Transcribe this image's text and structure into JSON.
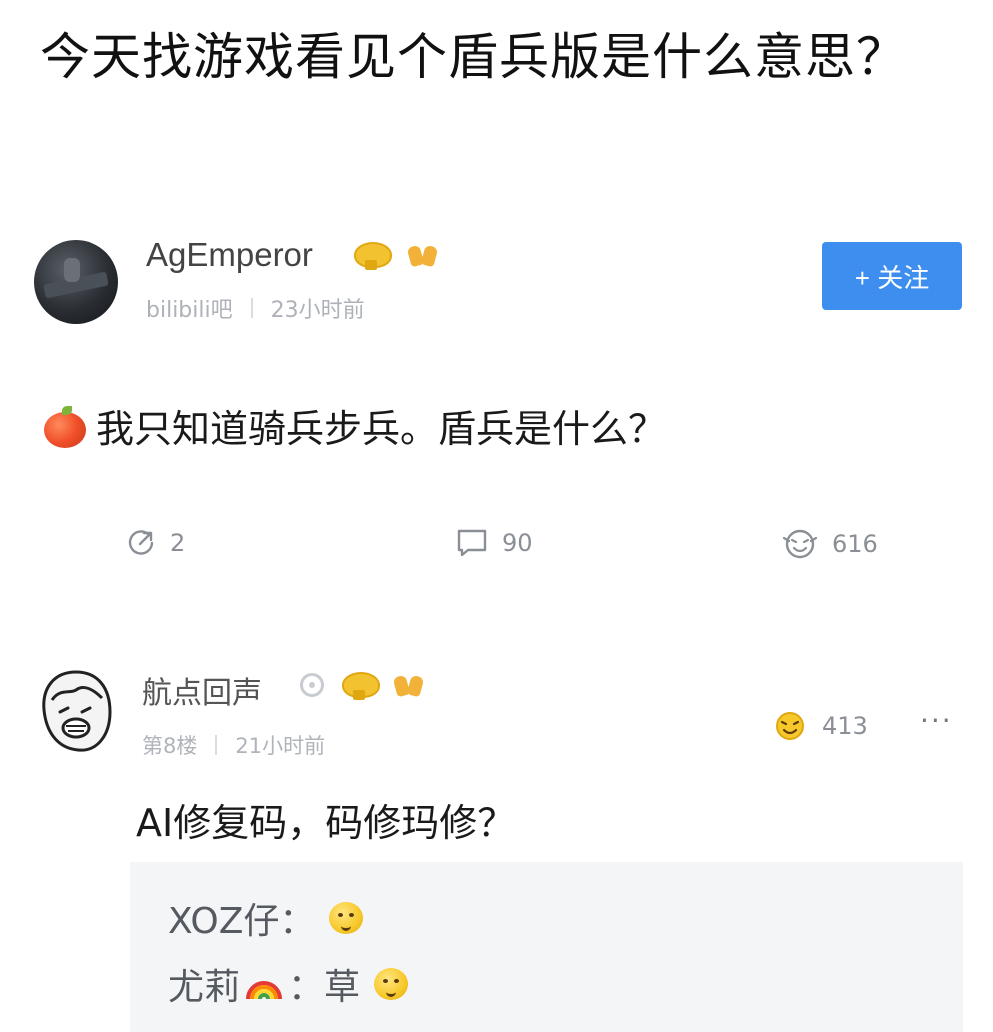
{
  "post": {
    "title": "今天找游戏看见个盾兵版是什么意思？",
    "author": {
      "name": "AgEmperor",
      "source": "bilibili吧",
      "time": "23小时前",
      "badge_icons": [
        "gold-medal-icon",
        "praying-hands-icon"
      ]
    },
    "follow_label": "+ 关注",
    "body_icon": "apple-icon",
    "body": "我只知道骑兵步兵。盾兵是什么？",
    "actions": {
      "share_count": "2",
      "comment_count": "90",
      "like_count": "616"
    }
  },
  "comment": {
    "author": "航点回声",
    "floor": "第8楼",
    "time": "21小时前",
    "like_count": "413",
    "more_label": "···",
    "text": "AI修复码，码修玛修？",
    "replies": [
      {
        "author": "XOZ仔",
        "separator": "：",
        "content": "",
        "emoji": "grin-face-icon"
      },
      {
        "author": "尤莉",
        "separator": "：",
        "content": "草",
        "emoji": "grin-face-icon",
        "author_icon": "rainbow-icon"
      }
    ]
  },
  "colors": {
    "follow_button": "#3e8ef0",
    "meta_text": "#aeb2b8",
    "reply_bg": "#f4f5f7"
  }
}
